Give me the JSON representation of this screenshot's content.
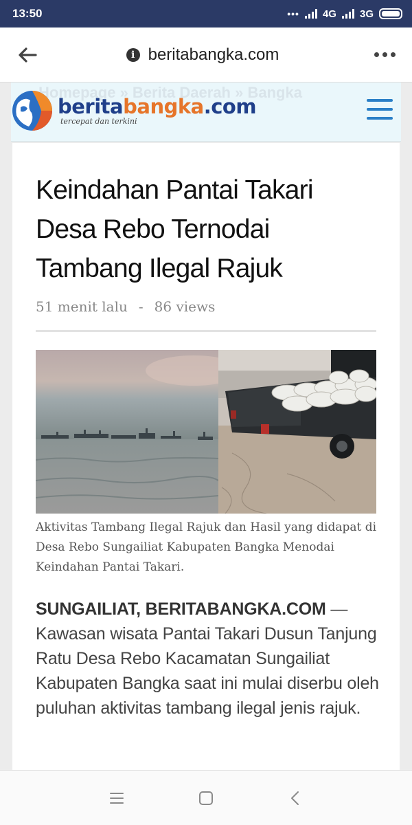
{
  "status_bar": {
    "time": "13:50",
    "dots": "•••",
    "network_1": "4G",
    "network_2": "3G"
  },
  "browser": {
    "url": "beritabangka.com"
  },
  "site": {
    "breadcrumb_ghost": "Homepage » Berita Daerah » Bangka",
    "logo_part1": "berita",
    "logo_part2": "bangka",
    "logo_part3": ".com",
    "tagline": "tercepat dan terkini"
  },
  "article": {
    "title": "Keindahan Pantai Takari Desa Rebo Ternodai Tambang Ilegal Rajuk",
    "time_ago": "51 menit lalu",
    "separator": "-",
    "views": "86 views",
    "caption": "Aktivitas Tambang Ilegal Rajuk dan Hasil yang didapat di Desa Rebo Sungailiat Kabupaten Bangka Menodai Keindahan Pantai Takari.",
    "lead": "SUNGAILIAT, BERITABANGKA.COM",
    "body": " — Kawasan wisata Pantai Takari Dusun Tanjung Ratu Desa Rebo Kacamatan Sungailiat Kabupaten Bangka saat ini mulai diserbu oleh puluhan aktivitas tambang ilegal jenis rajuk."
  },
  "colors": {
    "status_bar_bg": "#2b3a66",
    "brand_blue": "#1f3f8a",
    "brand_orange": "#e6752a",
    "menu_blue": "#2a7fc7"
  }
}
